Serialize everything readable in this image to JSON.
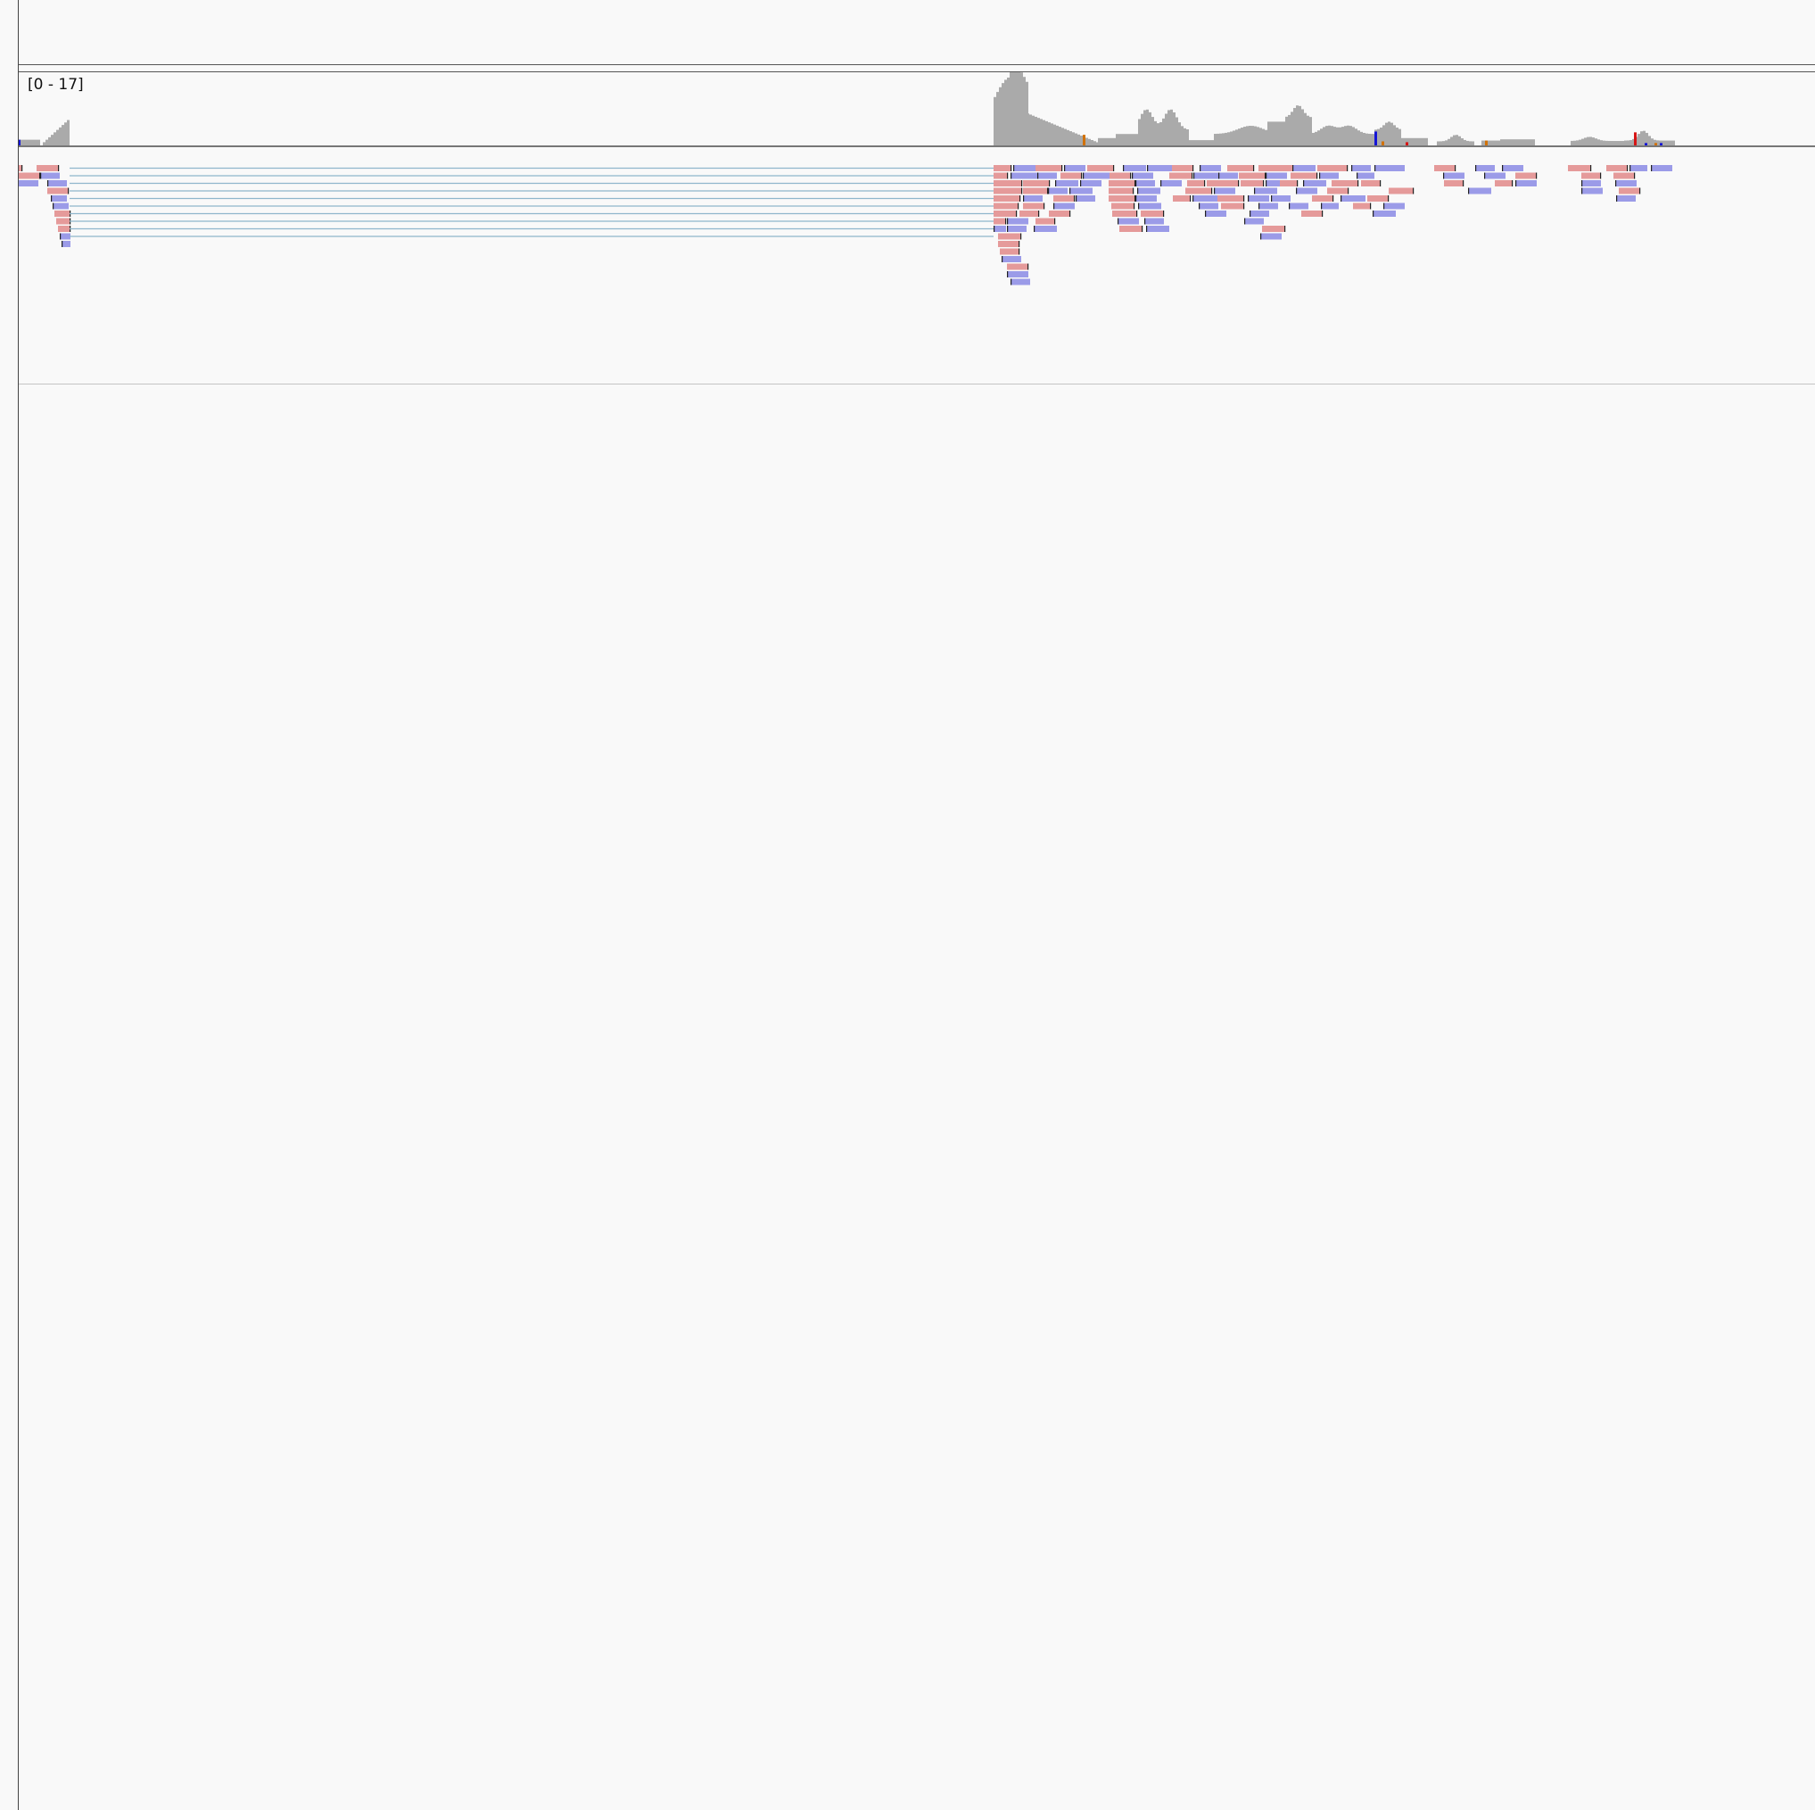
{
  "coverage": {
    "range_label": "[0 - 17]",
    "bar_color": "#aaaaaa",
    "mismatch_colors": {
      "A": "#1a9e1a",
      "C": "#1515d6",
      "G": "#d17105",
      "T": "#d61515"
    }
  },
  "alignments": {
    "forward_color": "#e59a9a",
    "reverse_color": "#9b9be8",
    "junction_color": "#8fb6cc",
    "softclip_color": "#222222"
  }
}
